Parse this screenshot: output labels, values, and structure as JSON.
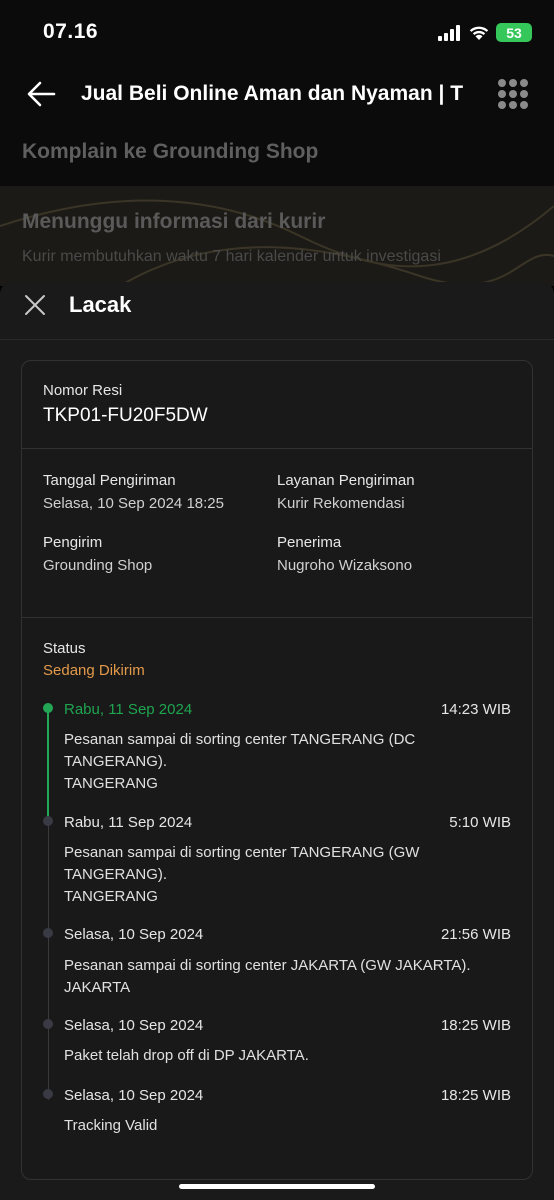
{
  "status_bar": {
    "time": "07.16",
    "battery": "53"
  },
  "header": {
    "title": "Jual Beli Online Aman dan Nyaman | T",
    "complain_link": "Komplain ke Grounding Shop"
  },
  "banner": {
    "title": "Menunggu informasi dari kurir",
    "subtitle": "Kurir membutuhkan waktu 7 hari kalender untuk investigasi"
  },
  "sheet": {
    "title": "Lacak",
    "resi_label": "Nomor Resi",
    "resi_value": "TKP01-FU20F5DW",
    "ship_date_label": "Tanggal Pengiriman",
    "ship_date_value": "Selasa, 10 Sep 2024 18:25",
    "service_label": "Layanan Pengiriman",
    "service_value": "Kurir Rekomendasi",
    "sender_label": "Pengirim",
    "sender_value": "Grounding Shop",
    "receiver_label": "Penerima",
    "receiver_value": "Nugroho Wizaksono",
    "status_label": "Status",
    "status_value": "Sedang Dikirim"
  },
  "timeline": [
    {
      "date": "Rabu, 11 Sep 2024",
      "time": "14:23 WIB",
      "desc": "Pesanan sampai di sorting center TANGERANG (DC TANGERANG).",
      "city": "TANGERANG",
      "active": true
    },
    {
      "date": "Rabu, 11 Sep 2024",
      "time": "5:10 WIB",
      "desc": "Pesanan sampai di sorting center TANGERANG (GW TANGERANG).",
      "city": "TANGERANG",
      "active": false
    },
    {
      "date": "Selasa, 10 Sep 2024",
      "time": "21:56 WIB",
      "desc": "Pesanan sampai di sorting center JAKARTA (GW JAKARTA).",
      "city": "JAKARTA",
      "active": false
    },
    {
      "date": "Selasa, 10 Sep 2024",
      "time": "18:25 WIB",
      "desc": "Paket telah drop off di DP JAKARTA.",
      "city": "",
      "active": false
    },
    {
      "date": "Selasa, 10 Sep 2024",
      "time": "18:25 WIB",
      "desc": "Tracking Valid",
      "city": "",
      "active": false
    }
  ],
  "colors": {
    "active_green": "#23a755",
    "status_orange": "#e39a4a",
    "battery_green": "#35c759"
  }
}
